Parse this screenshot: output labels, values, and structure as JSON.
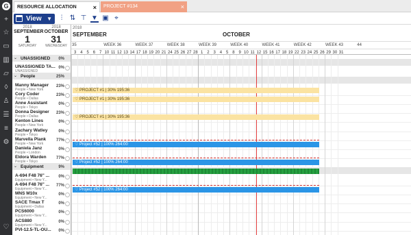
{
  "tabs": [
    {
      "label": "RESOURCE ALLOCATION",
      "close": "×"
    },
    {
      "label": "PROJECT #134",
      "close": "×"
    }
  ],
  "toolbar": {
    "view_label": "View"
  },
  "dates": {
    "start": {
      "year": "2018",
      "month": "SEPTEMBER",
      "day": "1",
      "weekday": "SATURDAY"
    },
    "end": {
      "year": "2018",
      "month": "OCTOBER",
      "day": "31",
      "weekday": "WEDNESDAY"
    }
  },
  "calendar": {
    "year": "2018",
    "months": [
      "SEPTEMBER",
      "OCTOBER"
    ],
    "weeks": [
      "35",
      "WEEK 36",
      "WEEK 37",
      "WEEK 38",
      "WEEK 39",
      "WEEK 40",
      "WEEK 41",
      "WEEK 42",
      "WEEK 43",
      "44"
    ],
    "days": [
      "3",
      "4",
      "5",
      "6",
      "7",
      "10",
      "11",
      "12",
      "13",
      "14",
      "17",
      "18",
      "19",
      "20",
      "21",
      "24",
      "25",
      "26",
      "27",
      "28",
      "1",
      "2",
      "3",
      "4",
      "5",
      "8",
      "9",
      "10",
      "11",
      "12",
      "15",
      "16",
      "17",
      "18",
      "19",
      "22",
      "23",
      "24",
      "25",
      "26",
      "29",
      "30",
      "31"
    ]
  },
  "rows": [
    {
      "name": "UNASSIGNED",
      "sub": "",
      "pct": "0",
      "group": true
    },
    {
      "name": "UNASSIGNED TA...",
      "sub": "UNASSIGNED",
      "pct": "0"
    },
    {
      "name": "People",
      "sub": "",
      "pct": "25",
      "group": true
    },
    {
      "name": "Manny Manager",
      "sub": "People • New York",
      "pct": "23"
    },
    {
      "name": "Cory Coder",
      "sub": "People • Dallas",
      "pct": "23"
    },
    {
      "name": "Anne Assistant",
      "sub": "People • Tokyo",
      "pct": "0"
    },
    {
      "name": "Donna Designer",
      "sub": "People • Dallas",
      "pct": "23"
    },
    {
      "name": "Kenton Lines",
      "sub": "People • New York",
      "pct": "0"
    },
    {
      "name": "Zachary Watley",
      "sub": "People • Tokyo",
      "pct": "0"
    },
    {
      "name": "Marvella Plank",
      "sub": "People • New York",
      "pct": "77"
    },
    {
      "name": "Daniela Janz",
      "sub": "People • London",
      "pct": "0"
    },
    {
      "name": "Eldora Warden",
      "sub": "People • Tokyo",
      "pct": "77"
    },
    {
      "name": "Equipment",
      "sub": "",
      "pct": "9",
      "group": true
    },
    {
      "name": "A-694 F48 76\" ...",
      "sub": "Equipment • New Y...",
      "pct": "0"
    },
    {
      "name": "A-694 F48 76\" ...",
      "sub": "Equipment • New Y...",
      "pct": "77"
    },
    {
      "name": "MNS M10x",
      "sub": "Equipment • New Y...",
      "pct": "0"
    },
    {
      "name": "SACE Tmax T",
      "sub": "Equipment • Dallas",
      "pct": "0"
    },
    {
      "name": "PCS6000",
      "sub": "Equipment • New Y...",
      "pct": "0"
    },
    {
      "name": "ACS880",
      "sub": "Equipment • New Y...",
      "pct": "0"
    },
    {
      "name": "PVI-12.5-TL-OU...",
      "sub": "",
      "pct": "0"
    }
  ],
  "bars": {
    "manny": "PROJECT #1 | 30% 195:36",
    "cory": "PROJECT #1 | 30% 195:36",
    "donna": "PROJECT #1 | 30% 195:36",
    "marvella": "Project #52 | 100% 264:00",
    "eldora": "Project #52 | 100% 264:00",
    "a694": "Project #52 | 100% 264:00"
  },
  "colors": {
    "primary": "#1d3f8c",
    "bar_yellow": "#fbe3a2",
    "bar_blue": "#2b95e6",
    "bar_green": "#25a040",
    "today": "#e23b3b",
    "project_tab": "#f1a184"
  }
}
